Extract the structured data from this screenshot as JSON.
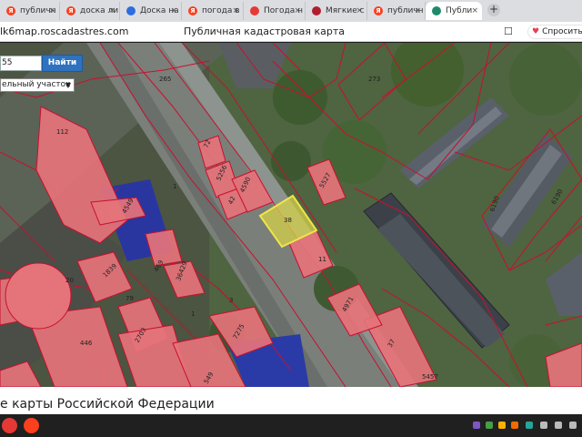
{
  "tabs": [
    {
      "label": "публичн",
      "favicon": "yandex-icon",
      "color": "#fc3f1d"
    },
    {
      "label": "доска ли",
      "favicon": "yandex-icon",
      "color": "#fc3f1d"
    },
    {
      "label": "Доска на",
      "favicon": "avito-icon",
      "color": "#2c6ee0"
    },
    {
      "label": "погода в",
      "favicon": "yandex-icon",
      "color": "#fc3f1d"
    },
    {
      "label": "Погода н",
      "favicon": "weather-icon",
      "color": "#e53935"
    },
    {
      "label": "Мягкие с",
      "favicon": "shop-icon",
      "color": "#b01e2f"
    },
    {
      "label": "публичн",
      "favicon": "yandex-icon",
      "color": "#fc3f1d"
    },
    {
      "label": "Публи",
      "favicon": "rosreestr-icon",
      "color": "#1e8a6b",
      "active": true
    }
  ],
  "address": {
    "url": "lk6map.roscadastres.com",
    "page_title": "Публичная кадастровая карта",
    "thanks_label": "Спросить"
  },
  "search": {
    "value": "55",
    "button_label": "Найти",
    "select_value": "ельный участок"
  },
  "footer": {
    "text": "е карты Российской Федерации"
  },
  "map_labels": [
    "265",
    "273",
    "112",
    "5527",
    "72",
    "5256",
    "42",
    "4590",
    "6190",
    "4549",
    "1",
    "38",
    "11",
    "6190",
    "469",
    "20",
    "1839",
    "36429",
    "79",
    "1",
    "3",
    "4971",
    "2703",
    "446",
    "7275",
    "549",
    "37",
    "5457"
  ]
}
